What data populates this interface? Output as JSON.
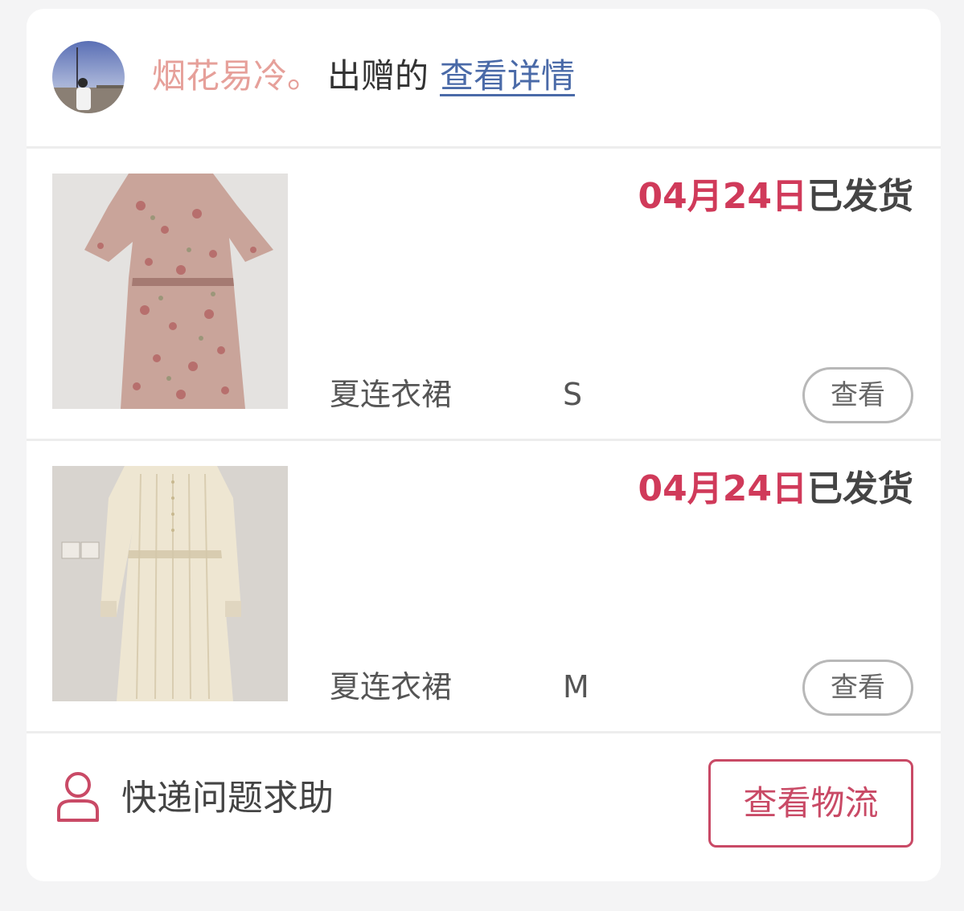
{
  "header": {
    "username": "烟花易冷。",
    "action_label": "出赠的",
    "detail_link": "查看详情"
  },
  "items": [
    {
      "date": "04月24日",
      "status": "已发货",
      "name": "夏连衣裙",
      "size": "S",
      "view_label": "查看",
      "image": "floral-dress-photo"
    },
    {
      "date": "04月24日",
      "status": "已发货",
      "name": "夏连衣裙",
      "size": "M",
      "view_label": "查看",
      "image": "cream-dress-photo"
    }
  ],
  "footer": {
    "help_label": "快递问题求助",
    "logistics_label": "查看物流",
    "icon": "user-icon"
  },
  "colors": {
    "accent": "#c94a66",
    "date_red": "#d03a5a",
    "username_pink": "#e6a09a",
    "link_blue": "#4a6aa8"
  }
}
